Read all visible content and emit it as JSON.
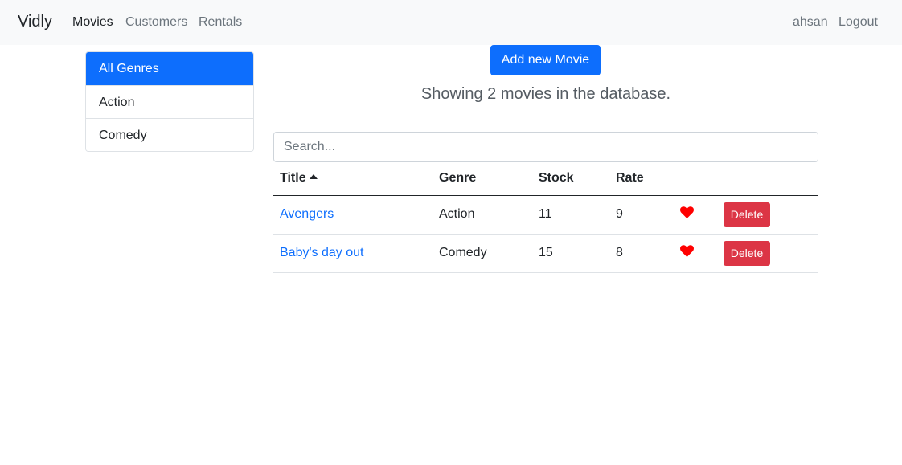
{
  "navbar": {
    "brand": "Vidly",
    "links": [
      {
        "label": "Movies",
        "active": true
      },
      {
        "label": "Customers",
        "active": false
      },
      {
        "label": "Rentals",
        "active": false
      }
    ],
    "user": "ahsan",
    "logout": "Logout"
  },
  "genres": [
    {
      "label": "All Genres",
      "active": true
    },
    {
      "label": "Action",
      "active": false
    },
    {
      "label": "Comedy",
      "active": false
    }
  ],
  "main": {
    "add_button": "Add new Movie",
    "count_text": "Showing 2 movies in the database.",
    "search_placeholder": "Search...",
    "columns": [
      "Title",
      "Genre",
      "Stock",
      "Rate"
    ],
    "sort_column": "Title",
    "sort_order": "asc",
    "rows": [
      {
        "title": "Avengers",
        "genre": "Action",
        "stock": "11",
        "rate": "9",
        "liked": true,
        "delete": "Delete"
      },
      {
        "title": "Baby's day out",
        "genre": "Comedy",
        "stock": "15",
        "rate": "8",
        "liked": true,
        "delete": "Delete"
      }
    ]
  },
  "colors": {
    "primary": "#0d6efd",
    "danger": "#dc3545",
    "heart": "#ff0000",
    "navbar_bg": "#f8f9fa"
  },
  "icons": {
    "sort": "caret-up-icon",
    "like": "heart-icon"
  }
}
